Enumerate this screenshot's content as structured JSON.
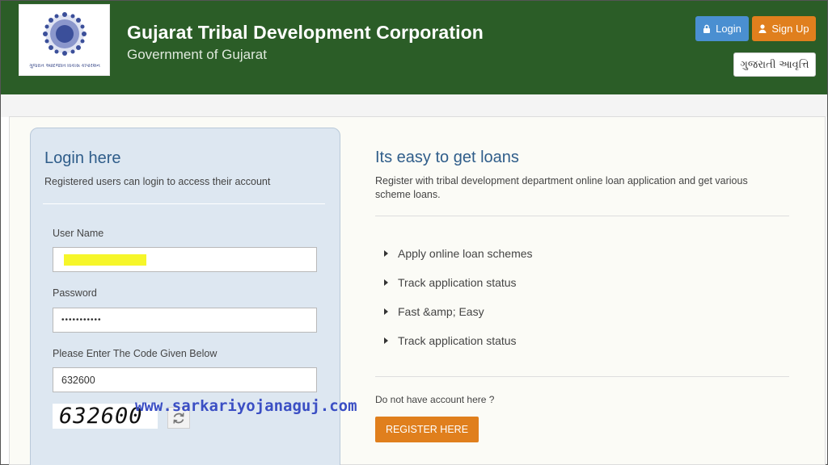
{
  "header": {
    "org_title": "Gujarat Tribal Development Corporation",
    "org_subtitle": "Government of Gujarat",
    "logo_caption": "ગુજરાત આદિજાતિ વિકાસ કોર્પોરેશન",
    "login_label": "Login",
    "signup_label": "Sign Up",
    "language_label": "ગુજરાતી આવૃત્તિ",
    "colors": {
      "header_bg": "#2b5d27",
      "login_btn": "#4a8fd1",
      "signup_btn": "#e07f1d"
    }
  },
  "login": {
    "title": "Login here",
    "description": "Registered users can login to access their account",
    "username_label": "User Name",
    "username_value": "",
    "password_label": "Password",
    "password_value": "•••••••••••",
    "code_label": "Please Enter The Code Given Below",
    "code_value": "632600",
    "captcha_text": "632600",
    "refresh_icon": "refresh-icon"
  },
  "watermark": "www.sarkariyojanaguj.com",
  "info": {
    "title": "Its easy to get loans",
    "description": "Register with tribal development department online loan application and get various scheme loans.",
    "features": [
      "Apply online loan schemes",
      "Track application status",
      "Fast &amp; Easy",
      "Track application status"
    ],
    "no_account_text": "Do not have account here ?",
    "register_label": "REGISTER HERE",
    "colors": {
      "register_btn": "#e07f1d"
    }
  }
}
